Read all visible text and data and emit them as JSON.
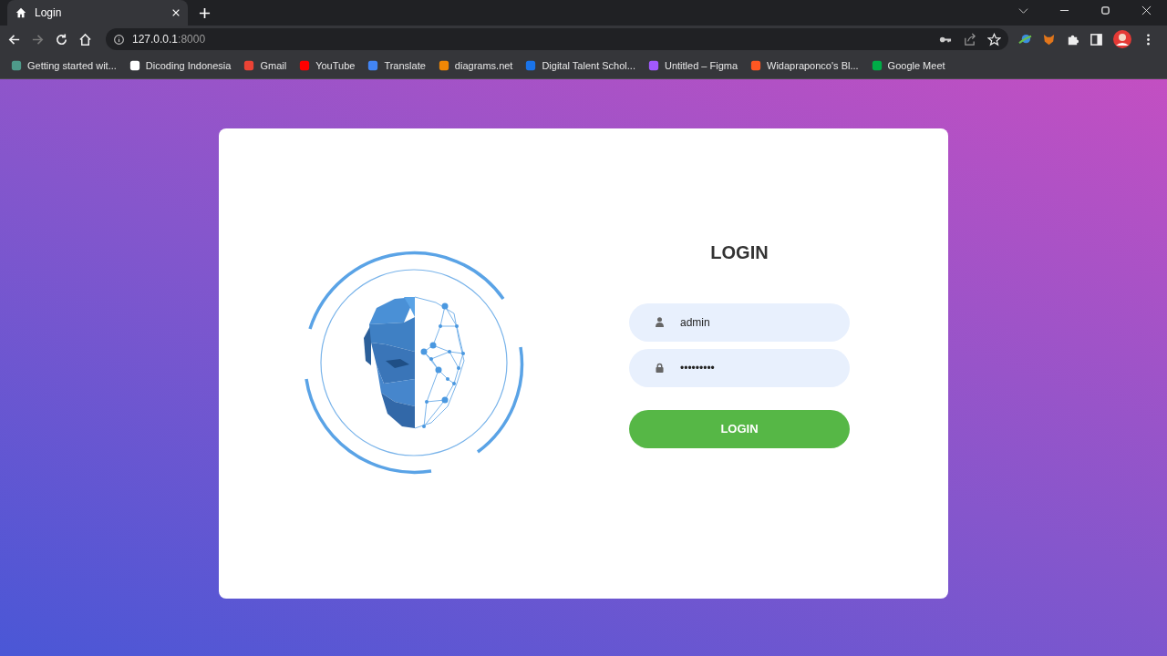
{
  "browser": {
    "tabs": [
      {
        "title": "Login",
        "selected": true
      }
    ],
    "address": {
      "host": "127.0.0.1",
      "port": ":8000"
    },
    "bookmarks": [
      {
        "label": "Getting started wit...",
        "color": "#4e9a8a"
      },
      {
        "label": "Dicoding Indonesia",
        "color": "#ffffff"
      },
      {
        "label": "Gmail",
        "color": "#ea4335"
      },
      {
        "label": "YouTube",
        "color": "#ff0000"
      },
      {
        "label": "Translate",
        "color": "#4285f4"
      },
      {
        "label": "diagrams.net",
        "color": "#f08705"
      },
      {
        "label": "Digital Talent Schol...",
        "color": "#1a73e8"
      },
      {
        "label": "Untitled – Figma",
        "color": "#a259ff"
      },
      {
        "label": "Widapraponco's Bl...",
        "color": "#ff5722"
      },
      {
        "label": "Google Meet",
        "color": "#00ac47"
      }
    ]
  },
  "login": {
    "title": "LOGIN",
    "fields": [
      {
        "kind": "user",
        "value": "admin"
      },
      {
        "kind": "lock",
        "value": "•••••••••"
      }
    ],
    "button": "LOGIN"
  }
}
